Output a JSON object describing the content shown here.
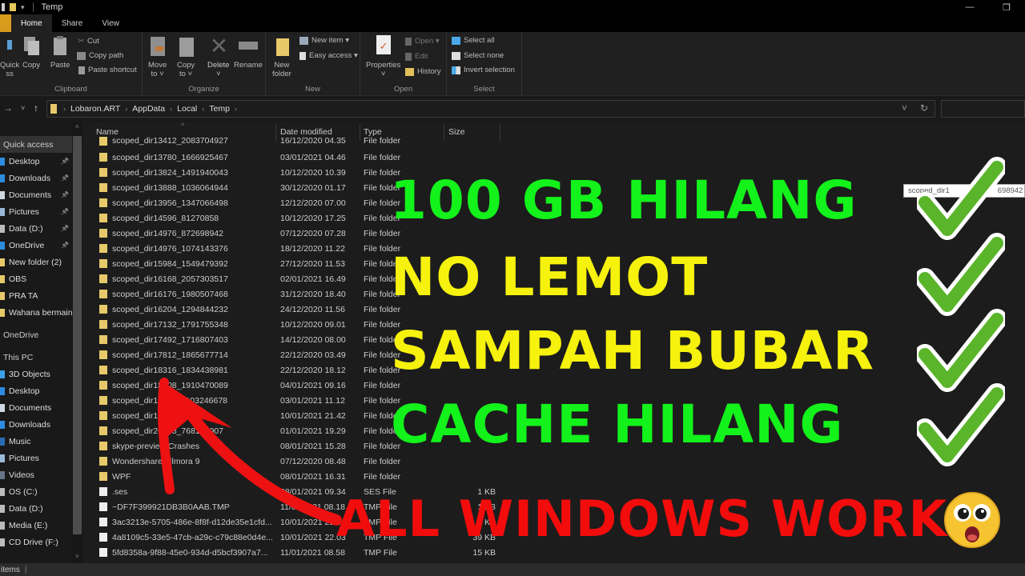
{
  "window": {
    "title": "Temp",
    "controls": {
      "minimize": "—",
      "maximize": "❐"
    }
  },
  "ribbon": {
    "tabs": [
      {
        "label": "Home",
        "active": true
      },
      {
        "label": "Share",
        "active": false
      },
      {
        "label": "View",
        "active": false
      }
    ],
    "clipboard": {
      "label": "Clipboard",
      "quick_access": "Quick\nss",
      "quick_access_l1": "Quick",
      "quick_access_l2": "ss",
      "copy": "Copy",
      "paste": "Paste",
      "cut": "Cut",
      "copy_path": "Copy path",
      "paste_shortcut": "Paste shortcut"
    },
    "organize": {
      "label": "Organize",
      "move_to_l1": "Move",
      "move_to_l2": "to ˅",
      "copy_to_l1": "Copy",
      "copy_to_l2": "to ˅",
      "delete": "Delete",
      "delete_arrow": "˅",
      "rename": "Rename"
    },
    "new": {
      "label": "New",
      "new_folder_l1": "New",
      "new_folder_l2": "folder",
      "new_item": "New item ▾",
      "easy_access": "Easy access ▾"
    },
    "open": {
      "label": "Open",
      "properties": "Properties",
      "properties_arrow": "˅",
      "open": "Open ▾",
      "edit": "Edit",
      "history": "History"
    },
    "select": {
      "label": "Select",
      "select_all": "Select all",
      "select_none": "Select none",
      "invert_selection": "Invert selection"
    }
  },
  "navigation": {
    "back": "→",
    "recent": "˅",
    "up": "↑",
    "breadcrumb": [
      "Lobaron.ART",
      "AppData",
      "Local",
      "Temp"
    ],
    "dropdown": "˅",
    "refresh": "↻",
    "search_placeholder": ""
  },
  "sidebar": {
    "items": [
      {
        "label": "Quick access",
        "kind": "header",
        "pinned": false,
        "color": ""
      },
      {
        "label": "Desktop",
        "kind": "item",
        "pinned": true,
        "color": "#2b8ce0"
      },
      {
        "label": "Downloads",
        "kind": "item",
        "pinned": true,
        "color": "#2b8ce0"
      },
      {
        "label": "Documents",
        "kind": "item",
        "pinned": true,
        "color": "#cfd8e0"
      },
      {
        "label": "Pictures",
        "kind": "item",
        "pinned": true,
        "color": "#9ab8d8"
      },
      {
        "label": "Data (D:)",
        "kind": "item",
        "pinned": true,
        "color": "#bbbbbb"
      },
      {
        "label": "OneDrive",
        "kind": "item",
        "pinned": true,
        "color": "#2b8ce0"
      },
      {
        "label": "New folder (2)",
        "kind": "item",
        "pinned": false,
        "color": "#e7c96b"
      },
      {
        "label": "OBS",
        "kind": "item",
        "pinned": false,
        "color": "#e7c96b"
      },
      {
        "label": "PRA TA",
        "kind": "item",
        "pinned": false,
        "color": "#e7c96b"
      },
      {
        "label": "Wahana bermain",
        "kind": "item",
        "pinned": false,
        "color": "#e7c96b"
      },
      {
        "label": "OneDrive",
        "kind": "header",
        "pinned": false,
        "color": ""
      },
      {
        "label": "This PC",
        "kind": "header",
        "pinned": false,
        "color": ""
      },
      {
        "label": "3D Objects",
        "kind": "item",
        "pinned": false,
        "color": "#3aa0e8"
      },
      {
        "label": "Desktop",
        "kind": "item",
        "pinned": false,
        "color": "#2b8ce0"
      },
      {
        "label": "Documents",
        "kind": "item",
        "pinned": false,
        "color": "#cfd8e0"
      },
      {
        "label": "Downloads",
        "kind": "item",
        "pinned": false,
        "color": "#2b8ce0"
      },
      {
        "label": "Music",
        "kind": "item",
        "pinned": false,
        "color": "#2b6cb0"
      },
      {
        "label": "Pictures",
        "kind": "item",
        "pinned": false,
        "color": "#9ab8d8"
      },
      {
        "label": "Videos",
        "kind": "item",
        "pinned": false,
        "color": "#667788"
      },
      {
        "label": "OS (C:)",
        "kind": "item",
        "pinned": false,
        "color": "#bbbbbb"
      },
      {
        "label": "Data (D:)",
        "kind": "item",
        "pinned": false,
        "color": "#bbbbbb"
      },
      {
        "label": "Media (E:)",
        "kind": "item",
        "pinned": false,
        "color": "#bbbbbb"
      },
      {
        "label": "CD Drive (F:)",
        "kind": "item",
        "pinned": false,
        "color": "#bbbbbb"
      }
    ]
  },
  "file_list": {
    "columns": {
      "name": "Name",
      "date": "Date modified",
      "type": "Type",
      "size": "Size"
    },
    "sort_indicator": "^",
    "rows": [
      {
        "name": "scoped_dir13412_2083704927",
        "date": "16/12/2020 04.35",
        "type": "File folder",
        "size": "",
        "kind": "folder"
      },
      {
        "name": "scoped_dir13780_1666925467",
        "date": "03/01/2021 04.46",
        "type": "File folder",
        "size": "",
        "kind": "folder"
      },
      {
        "name": "scoped_dir13824_1491940043",
        "date": "10/12/2020 10.39",
        "type": "File folder",
        "size": "",
        "kind": "folder"
      },
      {
        "name": "scoped_dir13888_1036064944",
        "date": "30/12/2020 01.17",
        "type": "File folder",
        "size": "",
        "kind": "folder"
      },
      {
        "name": "scoped_dir13956_1347066498",
        "date": "12/12/2020 07.00",
        "type": "File folder",
        "size": "",
        "kind": "folder"
      },
      {
        "name": "scoped_dir14596_81270858",
        "date": "10/12/2020 17.25",
        "type": "File folder",
        "size": "",
        "kind": "folder"
      },
      {
        "name": "scoped_dir14976_872698942",
        "date": "07/12/2020 07.28",
        "type": "File folder",
        "size": "",
        "kind": "folder"
      },
      {
        "name": "scoped_dir14976_1074143376",
        "date": "18/12/2020 11.22",
        "type": "File folder",
        "size": "",
        "kind": "folder"
      },
      {
        "name": "scoped_dir15984_1549479392",
        "date": "27/12/2020 11.53",
        "type": "File folder",
        "size": "",
        "kind": "folder"
      },
      {
        "name": "scoped_dir16168_2057303517",
        "date": "02/01/2021 16.49",
        "type": "File folder",
        "size": "",
        "kind": "folder"
      },
      {
        "name": "scoped_dir16176_1980507468",
        "date": "31/12/2020 18.40",
        "type": "File folder",
        "size": "",
        "kind": "folder"
      },
      {
        "name": "scoped_dir16204_1294844232",
        "date": "24/12/2020 11.56",
        "type": "File folder",
        "size": "",
        "kind": "folder"
      },
      {
        "name": "scoped_dir17132_1791755348",
        "date": "10/12/2020 09.01",
        "type": "File folder",
        "size": "",
        "kind": "folder"
      },
      {
        "name": "scoped_dir17492_1716807403",
        "date": "14/12/2020 08.00",
        "type": "File folder",
        "size": "",
        "kind": "folder"
      },
      {
        "name": "scoped_dir17812_1865677714",
        "date": "22/12/2020 03.49",
        "type": "File folder",
        "size": "",
        "kind": "folder"
      },
      {
        "name": "scoped_dir18316_1834438981",
        "date": "22/12/2020 18.12",
        "type": "File folder",
        "size": "",
        "kind": "folder"
      },
      {
        "name": "scoped_dir18508_1910470089",
        "date": "04/01/2021 09.16",
        "type": "File folder",
        "size": "",
        "kind": "folder"
      },
      {
        "name": "scoped_dir18624_1103246678",
        "date": "03/01/2021 11.12",
        "type": "File folder",
        "size": "",
        "kind": "folder"
      },
      {
        "name": "scoped_dir18748_305420",
        "date": "10/01/2021 21.42",
        "type": "File folder",
        "size": "",
        "kind": "folder"
      },
      {
        "name": "scoped_dir20468_768192907",
        "date": "01/01/2021 19.29",
        "type": "File folder",
        "size": "",
        "kind": "folder"
      },
      {
        "name": "skype-preview Crashes",
        "date": "08/01/2021 15.28",
        "type": "File folder",
        "size": "",
        "kind": "folder"
      },
      {
        "name": "Wondershare Filmora 9",
        "date": "07/12/2020 08.48",
        "type": "File folder",
        "size": "",
        "kind": "folder"
      },
      {
        "name": "WPF",
        "date": "08/01/2021 16.31",
        "type": "File folder",
        "size": "",
        "kind": "folder"
      },
      {
        "name": ".ses",
        "date": "08/01/2021 09.34",
        "type": "SES File",
        "size": "1 KB",
        "kind": "file"
      },
      {
        "name": "~DF7F399921DB3B0AAB.TMP",
        "date": "11/01/2021 08.18",
        "type": "TMP File",
        "size": "1 KB",
        "kind": "file"
      },
      {
        "name": "3ac3213e-5705-486e-8f8f-d12de35e1cfd...",
        "date": "10/01/2021 21.44",
        "type": "TMP File",
        "size": "1 KB",
        "kind": "file"
      },
      {
        "name": "4a8109c5-33e5-47cb-a29c-c79c88e0d4e...",
        "date": "10/01/2021 22.03",
        "type": "TMP File",
        "size": "39 KB",
        "kind": "file"
      },
      {
        "name": "5fd8358a-9f88-45e0-934d-d5bcf3907a7...",
        "date": "11/01/2021 08.58",
        "type": "TMP File",
        "size": "15 KB",
        "kind": "file"
      }
    ]
  },
  "tooltip": "scoped_dir14976_872698942",
  "tooltip_visible": "scoped_dir1",
  "tooltip_visible_end": "698942",
  "status_bar": {
    "text": "items"
  },
  "overlay": {
    "lines": [
      {
        "text": "100 GB HILANG",
        "color": "#13f21b"
      },
      {
        "text": "NO LEMOT",
        "color": "#f6f20d"
      },
      {
        "text": "SAMPAH BUBAR",
        "color": "#f6f20d"
      },
      {
        "text": "CACHE HILANG",
        "color": "#13f21b"
      },
      {
        "text": "ALL WINDOWS  WORK",
        "color": "#f20c0c"
      }
    ],
    "checkmarks": 4,
    "emoji": "astonished-face"
  }
}
